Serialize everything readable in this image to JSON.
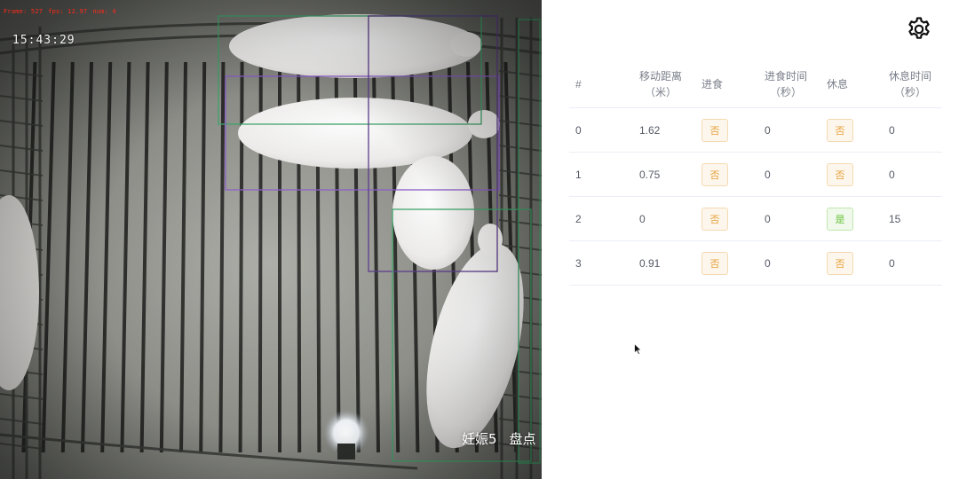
{
  "video": {
    "overlay_stats": [
      "Frame: 527",
      "fps: 12.97",
      "num: 4"
    ],
    "timestamp": "15:43:29",
    "caption_left": "妊娠5",
    "caption_right": "盘点"
  },
  "toolbar": {
    "settings_icon": "gear-icon"
  },
  "table": {
    "headers": {
      "index": "#",
      "distance_line1": "移动距离",
      "distance_line2": "（米）",
      "eating": "进食",
      "eat_time_line1": "进食时间",
      "eat_time_line2": "（秒）",
      "resting": "休息",
      "rest_time_line1": "休息时间",
      "rest_time_line2": "（秒）"
    },
    "rows": [
      {
        "index": "0",
        "distance": "1.62",
        "eating": "否",
        "eat_time": "0",
        "resting": "否",
        "rest_time": "0"
      },
      {
        "index": "1",
        "distance": "0.75",
        "eating": "否",
        "eat_time": "0",
        "resting": "否",
        "rest_time": "0"
      },
      {
        "index": "2",
        "distance": "0",
        "eating": "否",
        "eat_time": "0",
        "resting": "是",
        "rest_time": "15"
      },
      {
        "index": "3",
        "distance": "0.91",
        "eating": "否",
        "eat_time": "0",
        "resting": "否",
        "rest_time": "0"
      }
    ]
  },
  "colors": {
    "tag_no_text": "#e6a23c",
    "tag_yes_text": "#67c23a",
    "bbox_purple": "#8a5cc8",
    "bbox_green": "#3fa36a",
    "overlay_red": "#ff2a1a"
  }
}
